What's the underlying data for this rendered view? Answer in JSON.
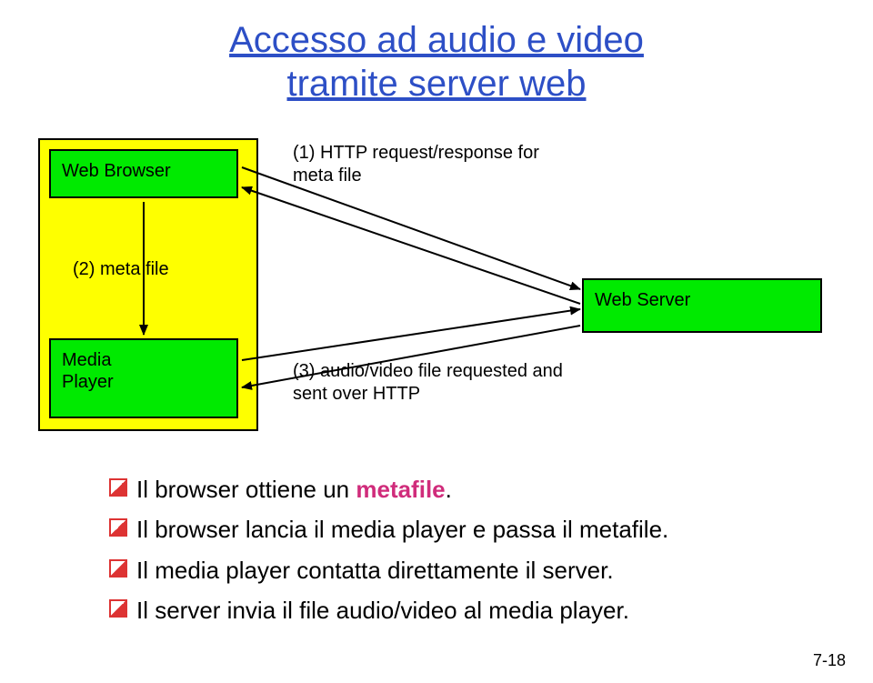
{
  "title_line1": "Accesso ad audio e video",
  "title_line2": "tramite server web",
  "boxes": {
    "web_browser": "Web Browser",
    "media_player": "Media\nPlayer",
    "web_server": "Web Server"
  },
  "labels": {
    "l1": "(1) HTTP request/response for meta file",
    "l2": "(2) meta file",
    "l3": "(3) audio/video file requested and sent over HTTP"
  },
  "bullets": {
    "b1_pre": "Il browser ottiene un ",
    "b1_em": "metafile",
    "b1_post": ".",
    "b2": "Il browser lancia il media player e passa il metafile.",
    "b3": "Il media player contatta direttamente il server.",
    "b4": "Il server invia il file audio/video al media player."
  },
  "pagenum": "7-18"
}
